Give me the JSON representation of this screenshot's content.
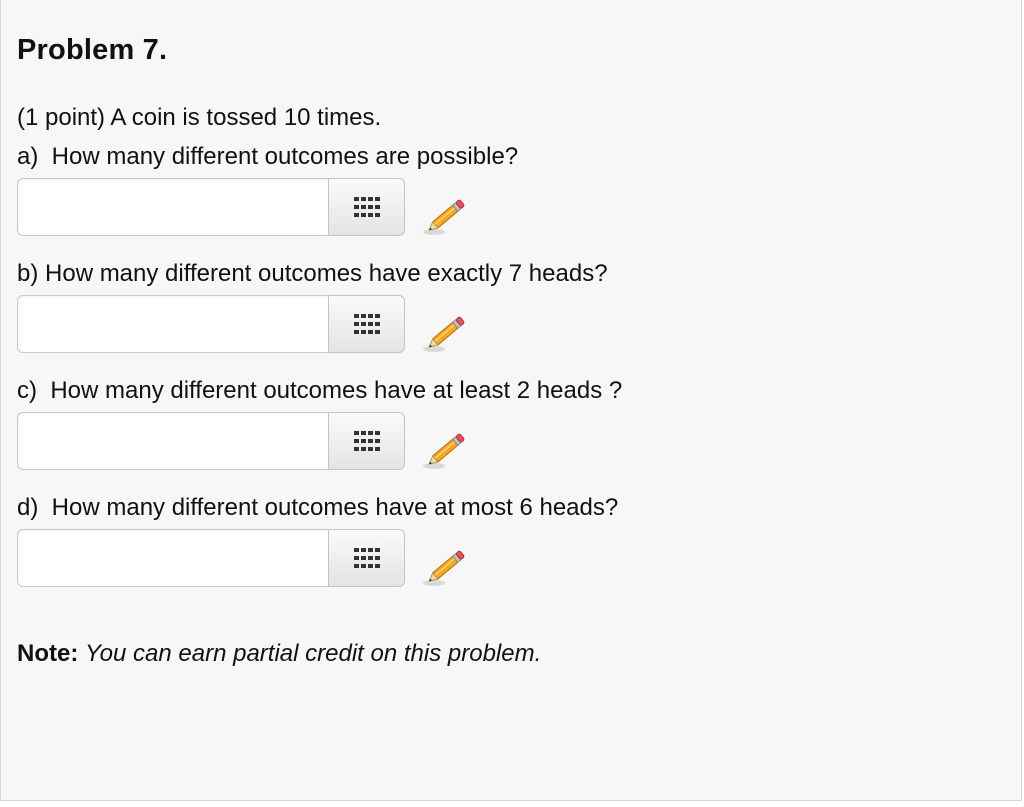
{
  "problem": {
    "title": "Problem 7.",
    "intro": "(1 point) A coin is tossed 10 times.",
    "questions": [
      {
        "label": "a)  How many different outcomes are possible?",
        "value": "",
        "placeholder": ""
      },
      {
        "label": "b) How many different outcomes have exactly 7 heads?",
        "value": "",
        "placeholder": ""
      },
      {
        "label": "c)  How many different outcomes have at least 2 heads ?",
        "value": "",
        "placeholder": ""
      },
      {
        "label": "d)  How many different outcomes have at most 6 heads?",
        "value": "",
        "placeholder": ""
      }
    ],
    "note_label": "Note:",
    "note_text": "You can earn partial credit on this problem."
  },
  "icons": {
    "keypad": "keypad-icon",
    "pencil": "pencil-icon"
  },
  "colors": {
    "panel_background": "#f7f7f7",
    "pencil_body": "#f5a623",
    "pencil_eraser": "#e8535b"
  }
}
